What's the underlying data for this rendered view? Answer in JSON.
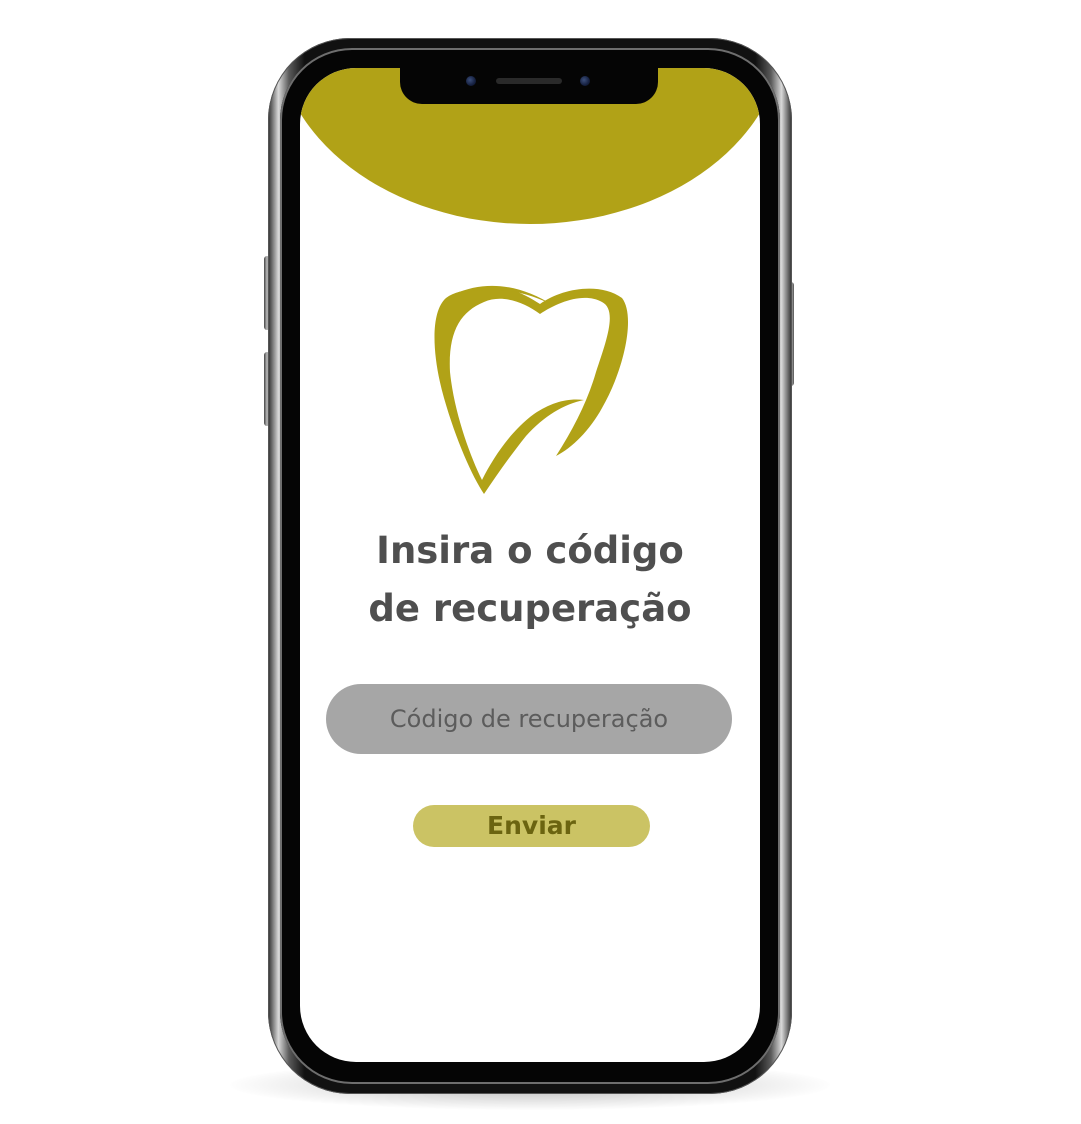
{
  "colors": {
    "brand": "#b1a217",
    "button_bg": "#cbc364",
    "button_text": "#6b6410",
    "field_bg": "#a6a6a6",
    "title_text": "#4f4f4f"
  },
  "logo": {
    "icon": "tooth-icon"
  },
  "heading": {
    "line1": "Insira o código",
    "line2": "de recuperação"
  },
  "recovery_code": {
    "value": "",
    "placeholder": "Código de recuperação"
  },
  "actions": {
    "send_label": "Enviar"
  }
}
